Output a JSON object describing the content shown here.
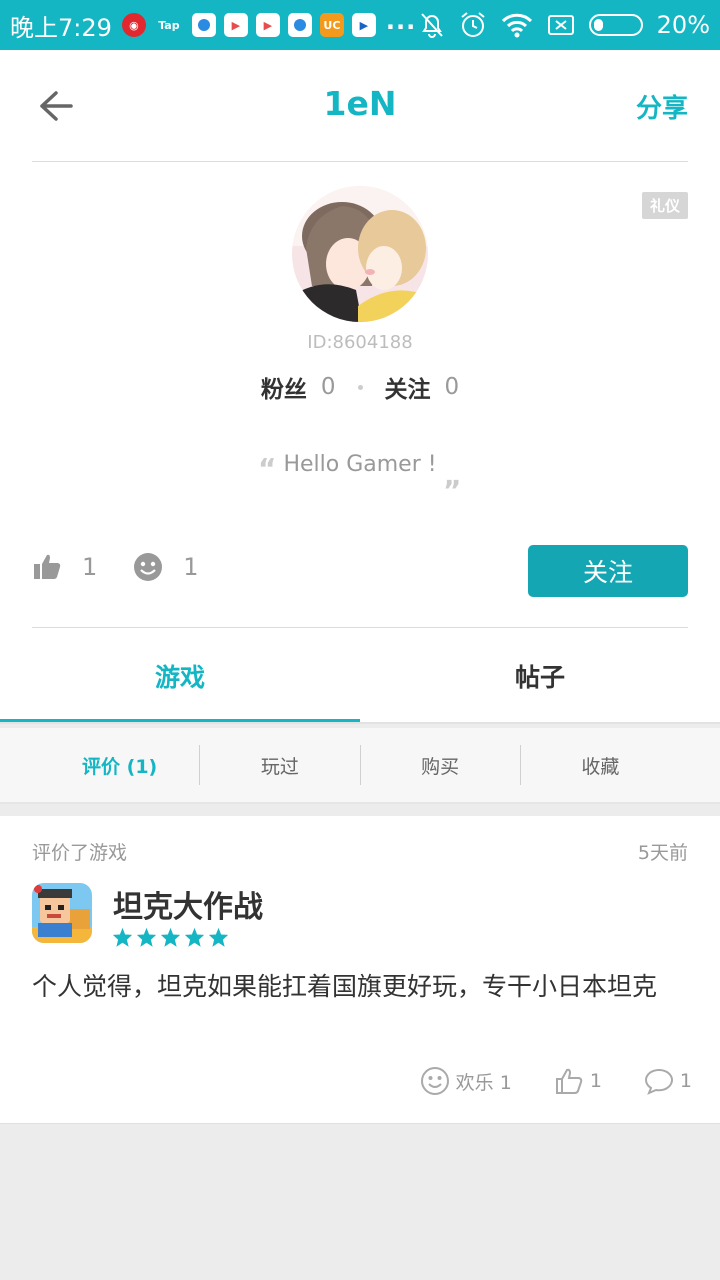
{
  "status_bar": {
    "time": "晚上7:29",
    "more": "...",
    "battery_percent": "20%",
    "battery_level": 0.2,
    "notification_icons": [
      "netease-music-icon",
      "tap-icon",
      "app-icon",
      "play-store-icon",
      "play-store-icon",
      "app-icon",
      "uc-browser-icon",
      "video-app-icon"
    ],
    "tap_label": "Tap"
  },
  "header": {
    "title": "1eN",
    "share_label": "分享"
  },
  "profile": {
    "badge": "礼仪",
    "user_id": "ID:8604188",
    "fans_label": "粉丝",
    "fans_count": "0",
    "following_label": "关注",
    "following_count": "0",
    "bio": "Hello Gamer !",
    "likes_count": "1",
    "fun_count": "1",
    "follow_button": "关注"
  },
  "tabs": [
    {
      "label": "游戏",
      "active": true
    },
    {
      "label": "帖子",
      "active": false
    }
  ],
  "subtabs": [
    {
      "label": "评价 (1)",
      "active": true
    },
    {
      "label": "玩过",
      "active": false
    },
    {
      "label": "购买",
      "active": false
    },
    {
      "label": "收藏",
      "active": false
    }
  ],
  "review_card": {
    "label": "评价了游戏",
    "time": "5天前",
    "game_name": "坦克大作战",
    "rating": 5,
    "review_text": "个人觉得，坦克如果能扛着国旗更好玩，专干小日本坦克",
    "fun_label": "欢乐 1",
    "like_count": "1",
    "comment_count": "1"
  },
  "colors": {
    "accent": "#15b6c4",
    "button": "#15a6b3"
  }
}
